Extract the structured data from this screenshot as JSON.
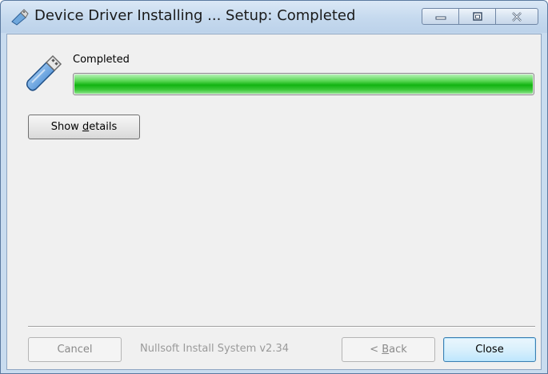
{
  "window": {
    "title": "Device Driver Installing ... Setup: Completed",
    "icons": {
      "title_icon": "installer-usb-icon"
    }
  },
  "caption_buttons": {
    "minimize_icon": "minimize-icon",
    "maximize_icon": "maximize-icon",
    "close_icon": "close-icon"
  },
  "main": {
    "header_icon": "usb-drive-icon",
    "status_text": "Completed",
    "progress_fraction": 1.0,
    "progress_color": "#12b312",
    "details_button": {
      "prefix": "Show ",
      "mnemonic": "d",
      "suffix": "etails"
    }
  },
  "footer": {
    "cancel_label": "Cancel",
    "branding": "Nullsoft Install System v2.34",
    "back_button": {
      "prefix": "< ",
      "mnemonic": "B",
      "suffix": "ack"
    },
    "close_label": "Close"
  }
}
